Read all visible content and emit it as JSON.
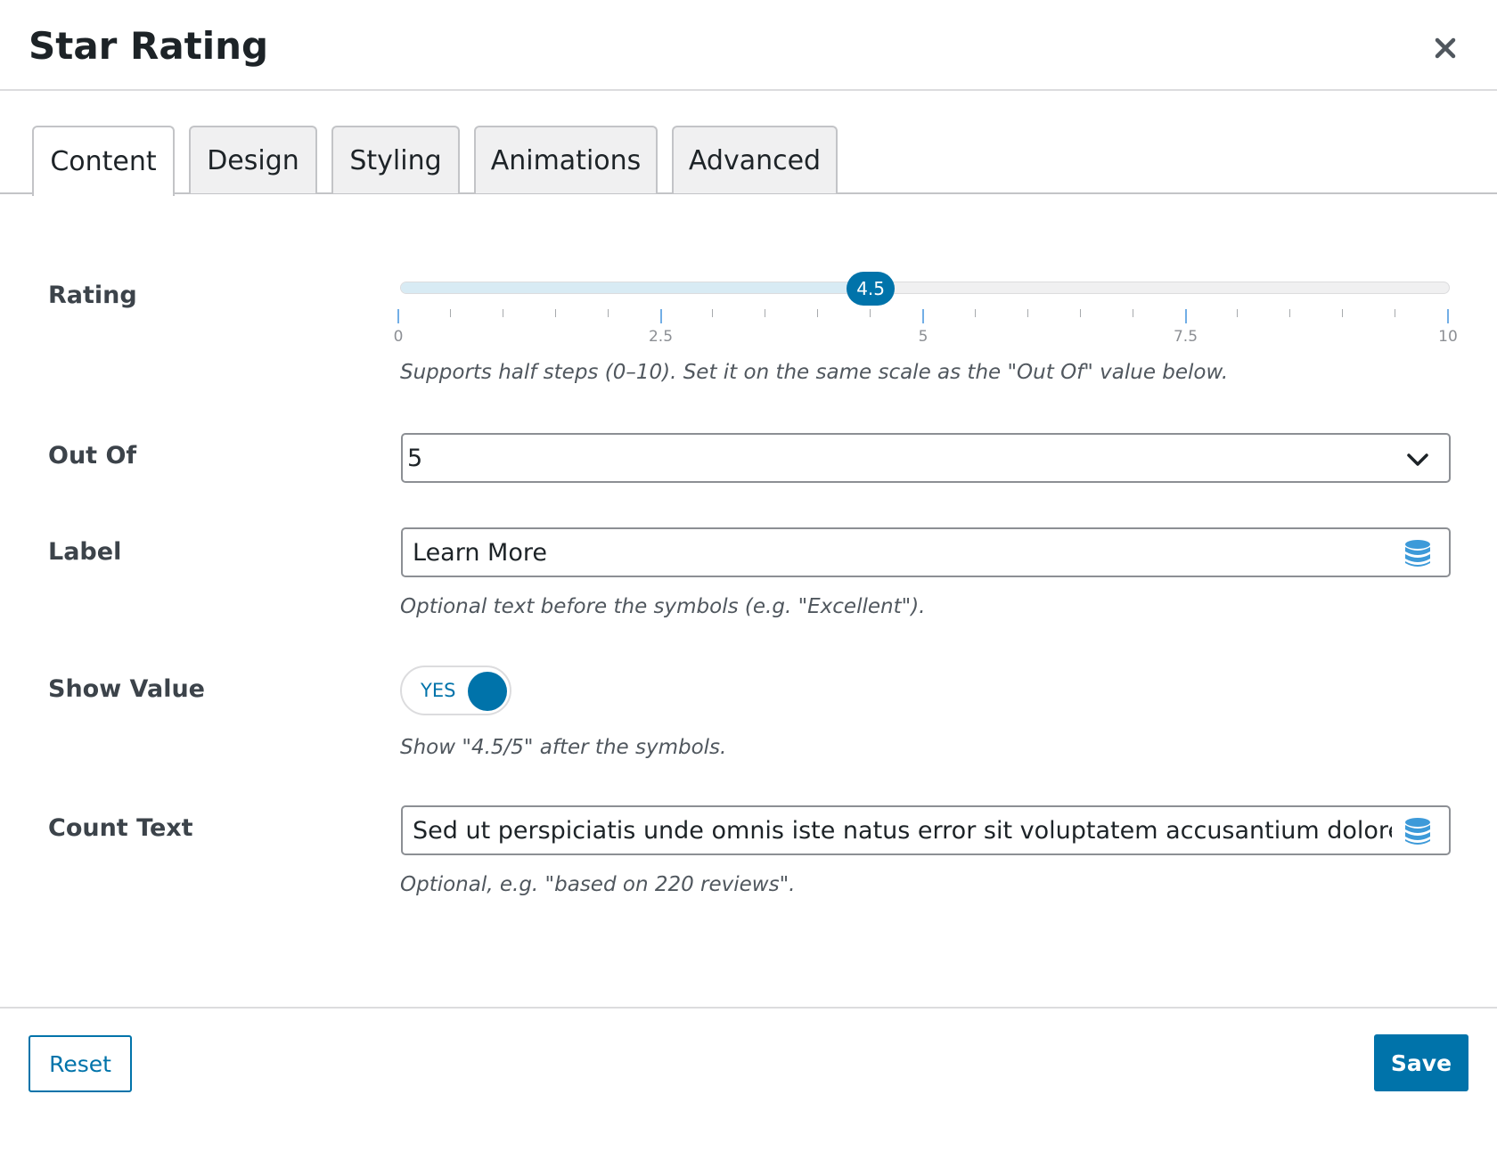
{
  "dialog": {
    "title": "Star Rating",
    "close_icon": "close-icon"
  },
  "tabs": [
    {
      "label": "Content",
      "active": true
    },
    {
      "label": "Design",
      "active": false
    },
    {
      "label": "Styling",
      "active": false
    },
    {
      "label": "Animations",
      "active": false
    },
    {
      "label": "Advanced",
      "active": false
    }
  ],
  "fields": {
    "rating": {
      "label": "Rating",
      "value": 4.5,
      "value_text": "4.5",
      "min": 0,
      "max": 10,
      "tick_labels": [
        "0",
        "2.5",
        "5",
        "7.5",
        "10"
      ],
      "help": "Supports half steps (0–10). Set it on the same scale as the \"Out Of\" value below."
    },
    "out_of": {
      "label": "Out Of",
      "value": "5",
      "icon": "chevron-down-icon"
    },
    "label": {
      "label": "Label",
      "value": "Learn More",
      "icon": "database-icon",
      "help": "Optional text before the symbols (e.g. \"Excellent\")."
    },
    "show_value": {
      "label": "Show Value",
      "toggle_text": "YES",
      "on": true,
      "help": "Show \"4.5/5\" after the symbols."
    },
    "count_text": {
      "label": "Count Text",
      "value": "Sed ut perspiciatis unde omnis iste natus error sit voluptatem accusantium doloremque la",
      "icon": "database-icon",
      "help": "Optional, e.g. \"based on 220 reviews\"."
    }
  },
  "footer": {
    "reset_label": "Reset",
    "save_label": "Save"
  },
  "colors": {
    "accent": "#0073aa",
    "slider_fill": "#d8ebf4",
    "tick": "#72aee6",
    "border": "#8c8f94"
  }
}
